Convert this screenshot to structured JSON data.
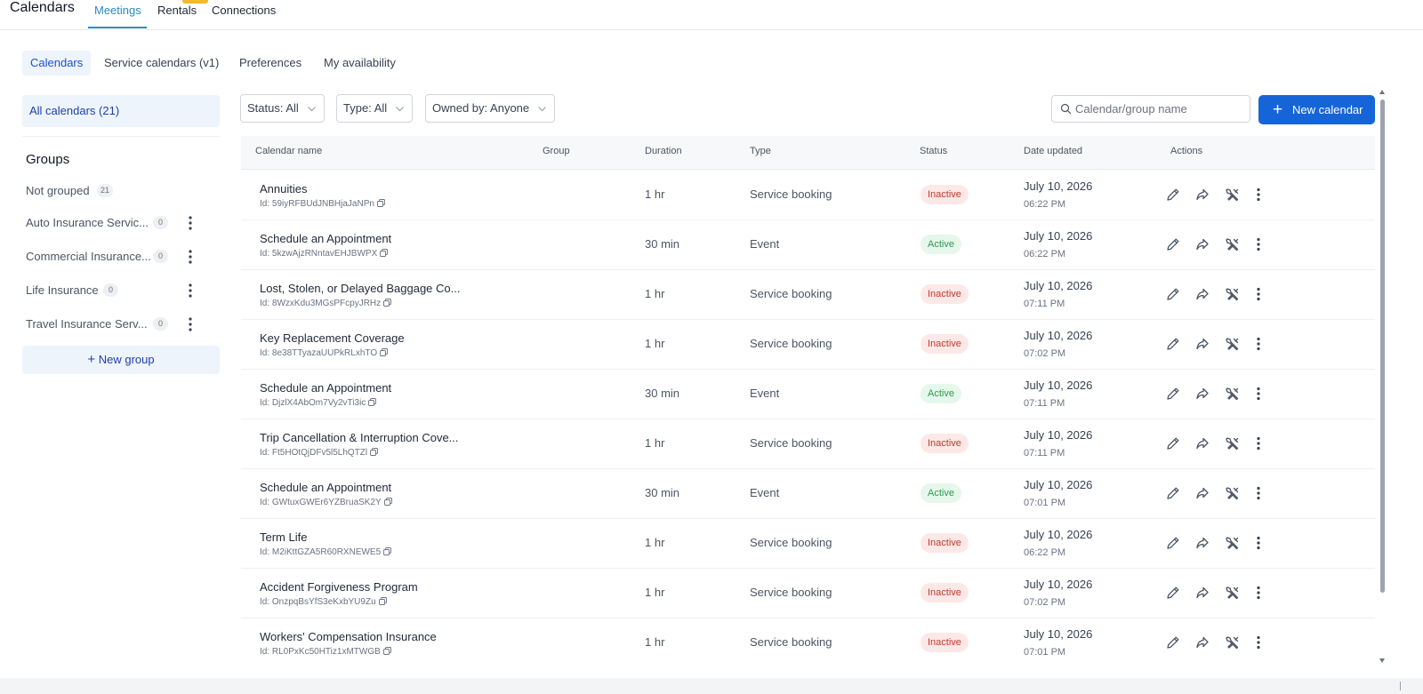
{
  "app": {
    "title": "Calendars"
  },
  "top_tabs": [
    {
      "label": "Meetings",
      "active": true
    },
    {
      "label": "Rentals"
    },
    {
      "label": "Connections"
    }
  ],
  "sub_tabs": [
    {
      "label": "Calendars",
      "active": true
    },
    {
      "label": "Service calendars (v1)"
    },
    {
      "label": "Preferences"
    },
    {
      "label": "My availability"
    }
  ],
  "sidebar": {
    "all_calendars": "All calendars (21)",
    "groups_title": "Groups",
    "groups": [
      {
        "label": "Not grouped",
        "count": "21"
      },
      {
        "label": "Auto Insurance Servic...",
        "count": "0"
      },
      {
        "label": "Commercial Insurance...",
        "count": "0"
      },
      {
        "label": "Life Insurance",
        "count": "0"
      },
      {
        "label": "Travel Insurance Serv...",
        "count": "0"
      }
    ],
    "new_group": "New group",
    "new_group_icon": "plus-icon"
  },
  "filters": {
    "status": "Status: All",
    "type": "Type: All",
    "owned_by": "Owned by: Anyone",
    "search_placeholder": "Calendar/group name",
    "new_calendar": "New calendar"
  },
  "table": {
    "columns": [
      "Calendar name",
      "Group",
      "Duration",
      "Type",
      "Status",
      "Date updated",
      "Actions"
    ],
    "rows": [
      {
        "name": "Annuities",
        "id": "Id: 59iyRFBUdJNBHjaJaNPn",
        "group": "",
        "duration": "1 hr",
        "type": "Service booking",
        "status": "Inactive",
        "date": "July 10, 2026",
        "time": "06:22 PM"
      },
      {
        "name": "Schedule an Appointment",
        "id": "Id: 5kzwAjzRNntavEHJBWPX",
        "group": "",
        "duration": "30 min",
        "type": "Event",
        "status": "Active",
        "date": "July 10, 2026",
        "time": "06:22 PM"
      },
      {
        "name": "Lost, Stolen, or Delayed Baggage Co...",
        "id": "Id: 8WzxKdu3MGsPFcpyJRHz",
        "group": "",
        "duration": "1 hr",
        "type": "Service booking",
        "status": "Inactive",
        "date": "July 10, 2026",
        "time": "07:11 PM"
      },
      {
        "name": "Key Replacement Coverage",
        "id": "Id: 8e38TTyazaUUPkRLxhTO",
        "group": "",
        "duration": "1 hr",
        "type": "Service booking",
        "status": "Inactive",
        "date": "July 10, 2026",
        "time": "07:02 PM"
      },
      {
        "name": "Schedule an Appointment",
        "id": "Id: DjzlX4AbOm7Vy2vTi3ic",
        "group": "",
        "duration": "30 min",
        "type": "Event",
        "status": "Active",
        "date": "July 10, 2026",
        "time": "07:11 PM"
      },
      {
        "name": "Trip Cancellation & Interruption Cove...",
        "id": "Id: Ft5HOtQjDFv5l5LhQTZl",
        "group": "",
        "duration": "1 hr",
        "type": "Service booking",
        "status": "Inactive",
        "date": "July 10, 2026",
        "time": "07:11 PM"
      },
      {
        "name": "Schedule an Appointment",
        "id": "Id: GWtuxGWEr6YZBruaSK2Y",
        "group": "",
        "duration": "30 min",
        "type": "Event",
        "status": "Active",
        "date": "July 10, 2026",
        "time": "07:01 PM"
      },
      {
        "name": "Term Life",
        "id": "Id: M2iKttGZA5R60RXNEWE5",
        "group": "",
        "duration": "1 hr",
        "type": "Service booking",
        "status": "Inactive",
        "date": "July 10, 2026",
        "time": "06:22 PM"
      },
      {
        "name": "Accident Forgiveness Program",
        "id": "Id: OnzpqBsYfS3eKxbYU9Zu",
        "group": "",
        "duration": "1 hr",
        "type": "Service booking",
        "status": "Inactive",
        "date": "July 10, 2026",
        "time": "07:02 PM"
      },
      {
        "name": "Workers' Compensation Insurance",
        "id": "Id: RL0PxKc50HTiz1xMTWGB",
        "group": "",
        "duration": "1 hr",
        "type": "Service booking",
        "status": "Inactive",
        "date": "July 10, 2026",
        "time": "07:01 PM"
      }
    ],
    "actions": [
      "pencil-icon",
      "share-icon",
      "tools-icon",
      "more-vertical-icon"
    ]
  },
  "colors": {
    "accent": "#1565d8",
    "tab_active": "#2d8ac0",
    "active_status": "#2e9a4e",
    "inactive_status": "#c0392b"
  }
}
